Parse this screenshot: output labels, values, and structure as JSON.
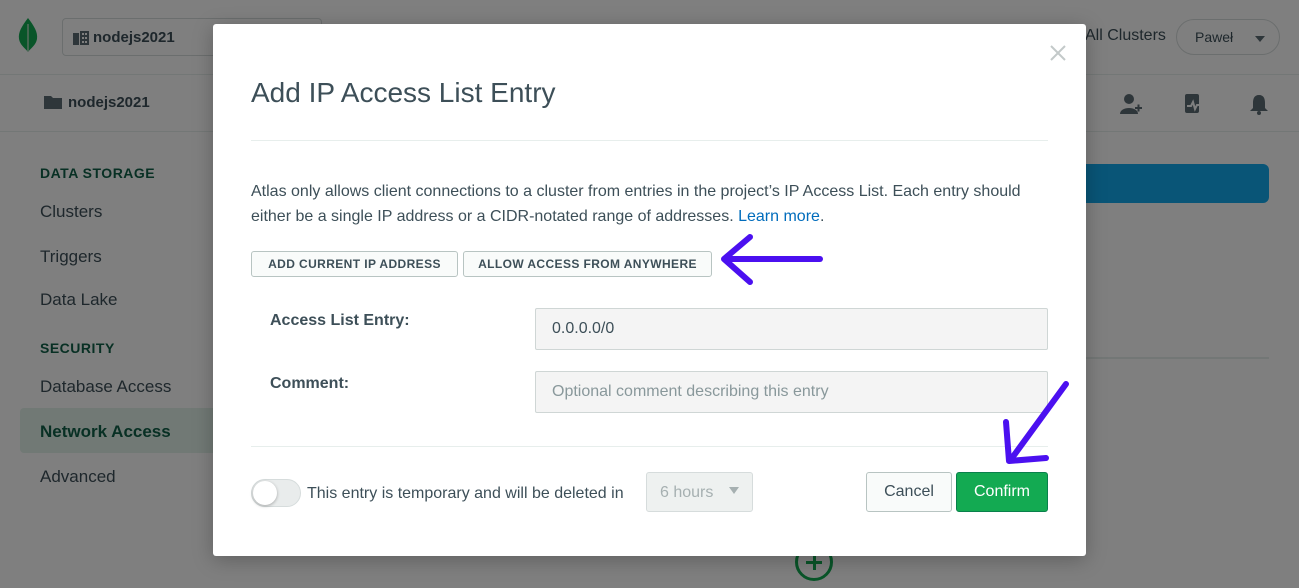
{
  "app": {
    "org_name": "nodejs2021",
    "all_clusters_label": "All Clusters",
    "user_name": "Paweł",
    "project_name": "nodejs2021",
    "brand_color": "#13aa52"
  },
  "sidebar": {
    "sections": [
      {
        "title": "DATA STORAGE",
        "items": [
          "Clusters",
          "Triggers",
          "Data Lake"
        ]
      },
      {
        "title": "SECURITY",
        "items": [
          "Database Access",
          "Network Access",
          "Advanced"
        ]
      }
    ],
    "active_item": "Network Access"
  },
  "modal": {
    "title": "Add IP Access List Entry",
    "description": "Atlas only allows client connections to a cluster from entries in the project’s IP Access List. Each entry should either be a single IP address or a CIDR-notated range of addresses.",
    "learn_more": "Learn more",
    "learn_more_suffix": ".",
    "add_current_ip_label": "ADD CURRENT IP ADDRESS",
    "allow_anywhere_label": "ALLOW ACCESS FROM ANYWHERE",
    "access_list_label": "Access List Entry:",
    "access_list_value": "0.0.0.0/0",
    "comment_label": "Comment:",
    "comment_placeholder": "Optional comment describing this entry",
    "temporary_label": "This entry is temporary and will be deleted in",
    "temporary_enabled": false,
    "duration_value": "6 hours",
    "cancel_label": "Cancel",
    "confirm_label": "Confirm"
  },
  "annotation_color": "#4b10f0"
}
